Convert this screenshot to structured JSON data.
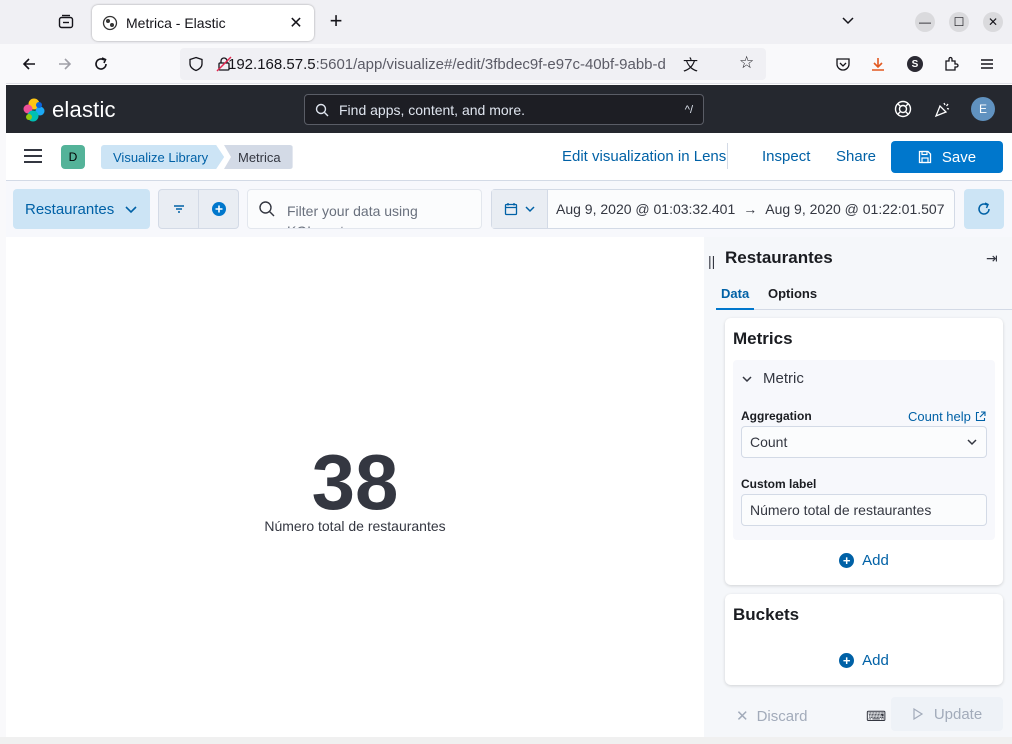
{
  "browser": {
    "tab_title": "Metrica - Elastic",
    "url_host": "192.168.57.5",
    "url_rest": ":5601/app/visualize#/edit/3fbdec9f-e97c-40bf-9abb-d",
    "profile_initial": "S"
  },
  "kibana": {
    "brand": "elastic",
    "search_placeholder": "Find apps, content, and more.",
    "search_shortcut": "^/",
    "user_initial": "E",
    "space_initial": "D",
    "breadcrumbs": [
      "Visualize Library",
      "Metrica"
    ],
    "top_links": {
      "lens": "Edit visualization in Lens",
      "inspect": "Inspect",
      "share": "Share",
      "save": "Save"
    },
    "query": {
      "index_pattern": "Restaurantes",
      "kql_placeholder": "Filter your data using KQL syntax",
      "start": "Aug 9, 2020 @ 01:03:32.401",
      "arrow": "→",
      "end": "Aug 9, 2020 @ 01:22:01.507"
    }
  },
  "visualization": {
    "value": "38",
    "label": "Número total de restaurantes"
  },
  "sidebar": {
    "title": "Restaurantes",
    "tabs": [
      "Data",
      "Options"
    ],
    "metrics_title": "Metrics",
    "metric_accordion": "Metric",
    "aggregation_label": "Aggregation",
    "help_link": "Count help",
    "aggregation_value": "Count",
    "custom_label_label": "Custom label",
    "custom_label_value": "Número total de restaurantes",
    "add": "Add",
    "buckets_title": "Buckets",
    "discard": "Discard",
    "update": "Update"
  },
  "colors": {
    "primary": "#0077cc",
    "header_bg": "#25282f",
    "space_badge": "#54b399",
    "avatar": "#6092c0"
  }
}
